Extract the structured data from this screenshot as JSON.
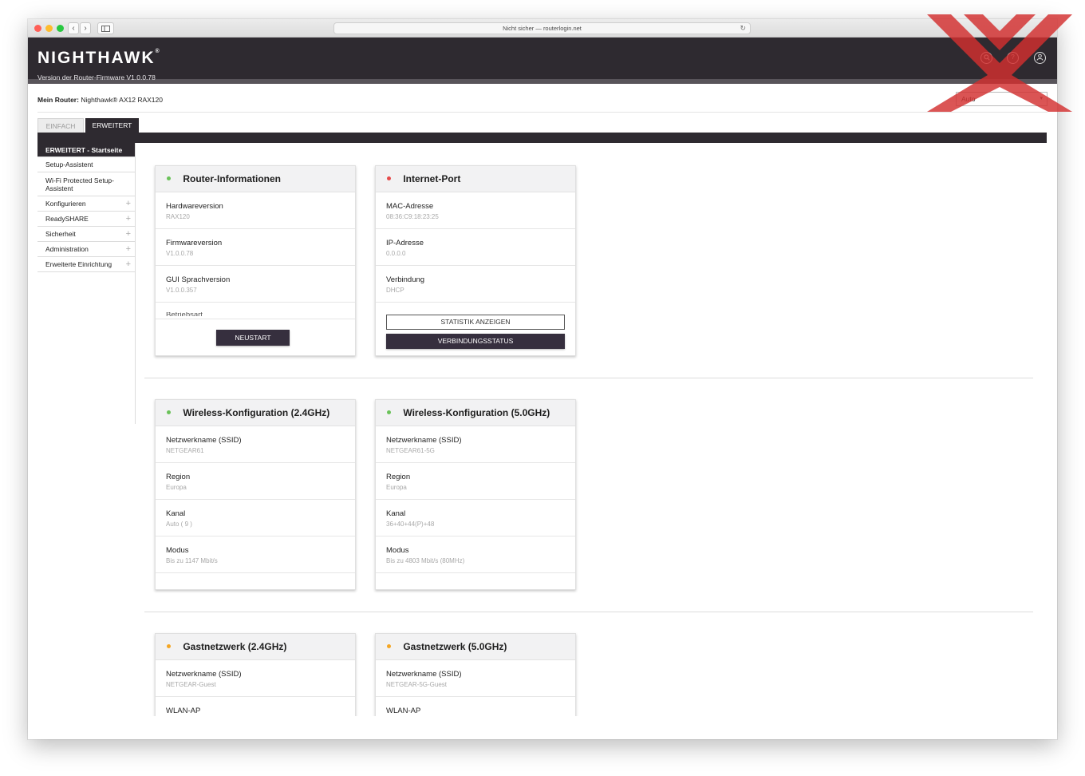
{
  "browser": {
    "address": "Nicht sicher — routerlogin.net"
  },
  "header": {
    "logo": "NIGHTHAWK",
    "firmware_label": "Version der Router-Firmware V1.0.0.78"
  },
  "router": {
    "label": "Mein Router:",
    "name": "Nighthawk® AX12 RAX120"
  },
  "language": {
    "selected": "Auto"
  },
  "tabs": [
    {
      "label": "EINFACH"
    },
    {
      "label": "ERWEITERT"
    }
  ],
  "sidebar": {
    "items": [
      {
        "label": "ERWEITERT - Startseite"
      },
      {
        "label": "Setup-Assistent"
      },
      {
        "label": "Wi-Fi Protected Setup-Assistent"
      },
      {
        "label": "Konfigurieren"
      },
      {
        "label": "ReadySHARE"
      },
      {
        "label": "Sicherheit"
      },
      {
        "label": "Administration"
      },
      {
        "label": "Erweiterte Einrichtung"
      }
    ]
  },
  "cards": {
    "router_info": {
      "title": "Router-Informationen",
      "status_color": "#6ac259",
      "rows": [
        {
          "label": "Hardwareversion",
          "value": "RAX120"
        },
        {
          "label": "Firmwareversion",
          "value": "V1.0.0.78"
        },
        {
          "label": "GUI Sprachversion",
          "value": "V1.0.0.357"
        },
        {
          "label": "Betriebsart",
          "value": ""
        }
      ],
      "button": "NEUSTART"
    },
    "internet_port": {
      "title": "Internet-Port",
      "status_color": "#e64a4a",
      "rows": [
        {
          "label": "MAC-Adresse",
          "value": "08:36:C9:18:23:25"
        },
        {
          "label": "IP-Adresse",
          "value": "0.0.0.0"
        },
        {
          "label": "Verbindung",
          "value": "DHCP"
        }
      ],
      "button_stats": "STATISTIK ANZEIGEN",
      "button_status": "VERBINDUNGSSTATUS"
    },
    "wireless_24": {
      "title": "Wireless-Konfiguration (2.4GHz)",
      "status_color": "#6ac259",
      "rows": [
        {
          "label": "Netzwerkname (SSID)",
          "value": "NETGEAR61"
        },
        {
          "label": "Region",
          "value": "Europa"
        },
        {
          "label": "Kanal",
          "value": "Auto ( 9 )"
        },
        {
          "label": "Modus",
          "value": "Bis zu 1147 Mbit/s"
        }
      ]
    },
    "wireless_50": {
      "title": "Wireless-Konfiguration (5.0GHz)",
      "status_color": "#6ac259",
      "rows": [
        {
          "label": "Netzwerkname (SSID)",
          "value": "NETGEAR61-5G"
        },
        {
          "label": "Region",
          "value": "Europa"
        },
        {
          "label": "Kanal",
          "value": "36+40+44(P)+48"
        },
        {
          "label": "Modus",
          "value": "Bis zu 4803 Mbit/s (80MHz)"
        }
      ]
    },
    "guest_24": {
      "title": "Gastnetzwerk (2.4GHz)",
      "status_color": "#f5a623",
      "rows": [
        {
          "label": "Netzwerkname (SSID)",
          "value": "NETGEAR-Guest"
        },
        {
          "label": "WLAN-AP",
          "value": ""
        }
      ]
    },
    "guest_50": {
      "title": "Gastnetzwerk (5.0GHz)",
      "status_color": "#f5a623",
      "rows": [
        {
          "label": "Netzwerkname (SSID)",
          "value": "NETGEAR-5G-Guest"
        },
        {
          "label": "WLAN-AP",
          "value": ""
        }
      ]
    }
  },
  "colors": {
    "header_bg": "#2e2a30",
    "button_dark": "#362f3e",
    "watermark": "#d32f2f"
  }
}
